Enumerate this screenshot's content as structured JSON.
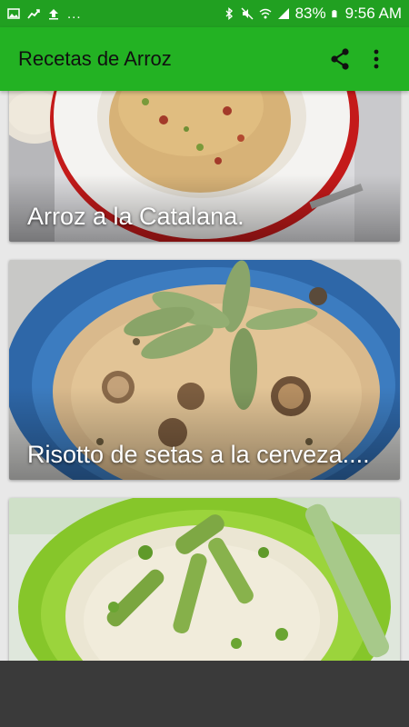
{
  "status_bar": {
    "battery_percent": "83%",
    "time": "9:56 AM",
    "overflow": "..."
  },
  "app_bar": {
    "title": "Recetas de Arroz",
    "share_icon": "share-icon",
    "menu_icon": "more-vert-icon"
  },
  "recipes": [
    {
      "title": "Arroz a la Catalana.",
      "image": "rice-dish-white-bowl"
    },
    {
      "title": "Risotto de setas a la cerveza....",
      "image": "mushroom-risotto-blue-bowl"
    },
    {
      "title": "",
      "image": "asparagus-rice-green-bowl"
    }
  ],
  "colors": {
    "status_bar": "#21a021",
    "app_bar": "#23b223",
    "bottom_bar": "#3a3a3a"
  }
}
